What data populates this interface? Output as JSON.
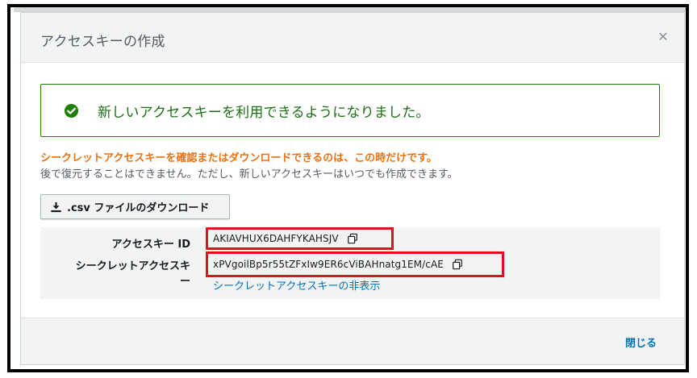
{
  "modal": {
    "title": "アクセスキーの作成",
    "close_icon": "close-icon"
  },
  "success": {
    "icon": "check-circle-icon",
    "message": "新しいアクセスキーを利用できるようになりました。"
  },
  "warning": {
    "text": "シークレットアクセスキーを確認またはダウンロードできるのは、この時だけです。"
  },
  "info": {
    "text": "後で復元することはできません。ただし、新しいアクセスキーはいつでも作成できます。"
  },
  "download": {
    "icon": "download-icon",
    "label": ".csv ファイルのダウンロード"
  },
  "keys": {
    "access_key_label": "アクセスキー ID",
    "access_key_value": "AKIAVHUX6DAHFYKAHSJV",
    "secret_key_label_line1": "シークレットアクセスキ",
    "secret_key_label_line2": "ー",
    "secret_key_value": "xPVgoilBp5r55tZFxIw9ER6cViBAHnatg1EM/cAE",
    "hide_secret_link": "シークレットアクセスキーの非表示",
    "copy_icon": "copy-icon"
  },
  "footer": {
    "close_label": "閉じる"
  },
  "colors": {
    "success": "#1d8102",
    "warning": "#ec7211",
    "link": "#0073bb",
    "highlight_box": "#e0101d"
  }
}
